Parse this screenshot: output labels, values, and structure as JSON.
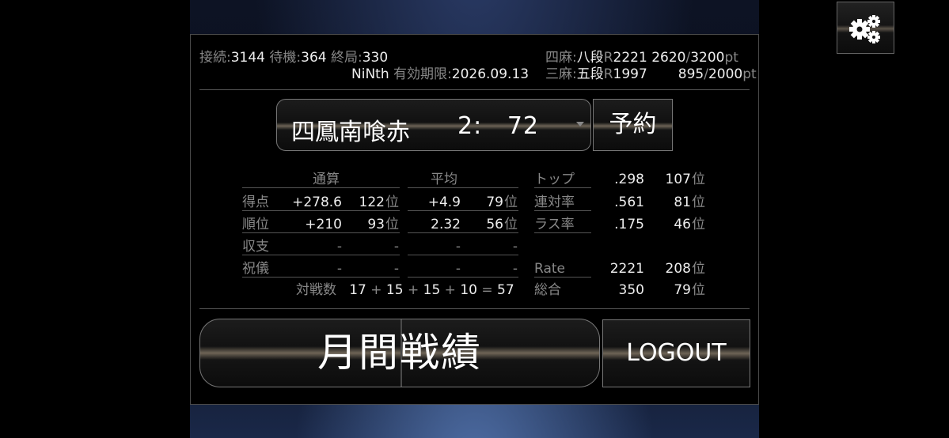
{
  "header": {
    "connect_label": "接続:",
    "connect_value": "3144",
    "wait_label": "待機:",
    "wait_value": "364",
    "end_label": "終局:",
    "end_value": "330",
    "username": "NiNth",
    "expiry_label": "有効期限:",
    "expiry_value": "2026.09.13",
    "four_player_label": "四麻:",
    "four_player_rank": "八段",
    "four_player_rate_label": "R",
    "four_player_rate": "2221",
    "four_player_pt": "2620",
    "four_player_pt_max": "3200",
    "three_player_label": "三麻:",
    "three_player_rank": "五段",
    "three_player_rate_label": "R",
    "three_player_rate": "1997",
    "three_player_pt": "895",
    "three_player_pt_max": "2000",
    "slash": "/",
    "pt_unit": "pt"
  },
  "room_select": {
    "name": "四鳳南喰赤",
    "count": "2:",
    "wait": "72"
  },
  "reserve_label": "予約",
  "stats": {
    "col_total": "通算",
    "col_avg": "平均",
    "rank_suffix": "位",
    "rows": [
      {
        "label": "得点",
        "total": "+278.6",
        "total_rank": "122",
        "avg": "+4.9",
        "avg_rank": "79"
      },
      {
        "label": "順位",
        "total": "+210",
        "total_rank": "93",
        "avg": "2.32",
        "avg_rank": "56"
      },
      {
        "label": "収支",
        "total": "-",
        "total_rank": "-",
        "avg": "-",
        "avg_rank": "-"
      },
      {
        "label": "祝儀",
        "total": "-",
        "total_rank": "-",
        "avg": "-",
        "avg_rank": "-"
      }
    ],
    "right_rows": [
      {
        "label": "トップ",
        "value": ".298",
        "rank": "107"
      },
      {
        "label": "連対率",
        "value": ".561",
        "rank": "81"
      },
      {
        "label": "ラス率",
        "value": ".175",
        "rank": "46"
      },
      {
        "label": "Rate",
        "value": "2221",
        "rank": "208"
      },
      {
        "label": "総合",
        "value": "350",
        "rank": "79"
      }
    ],
    "match_count_label": "対戦数",
    "match_counts": [
      "17",
      "15",
      "15",
      "10"
    ],
    "match_total": "57",
    "plus": "+",
    "equals": "="
  },
  "buttons": {
    "monthly": "月間戦績",
    "logout": "LOGOUT"
  },
  "icons": {
    "settings": "gears-icon"
  }
}
